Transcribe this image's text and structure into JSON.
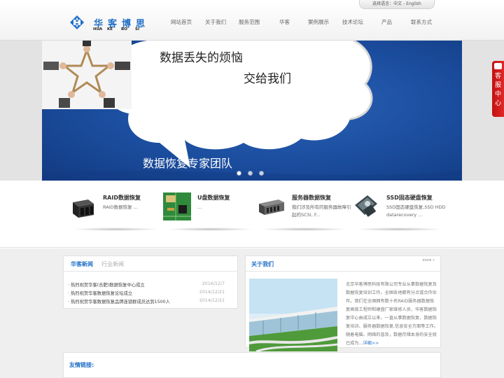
{
  "header": {
    "language": {
      "label": "选择语言：",
      "zh": "中文",
      "sep": " - ",
      "en": "English"
    },
    "logo": {
      "cn": "华客博思",
      "en": [
        "HUA",
        "KE",
        "BO",
        "SI"
      ]
    },
    "nav": [
      "网站首页",
      "关于我们",
      "服务范围",
      "华客",
      "案例展示",
      "技术论坛",
      "产品",
      "联系方式"
    ]
  },
  "banner": {
    "line1": "数据丢失的烦恼",
    "line2": "交给我们",
    "line3": "数据恢复专家团队",
    "slide_count": 3,
    "active_slide": 1
  },
  "side_tab": {
    "label": "客服中心"
  },
  "services": [
    {
      "title": "RAID数据恢复",
      "desc": "RAID数据恢复 ..."
    },
    {
      "title": "U盘数据恢复",
      "desc": "..."
    },
    {
      "title": "服务器数据恢复",
      "desc": "我们涉及所有的服务器故障引起的SCSI, F..."
    },
    {
      "title": "SSD固态硬盘恢复",
      "desc": "SSD固态硬盘恢复,SSD HDD datarecovery ..."
    }
  ],
  "news": {
    "tabs": [
      "华客新闻",
      "行业新闻"
    ],
    "items": [
      {
        "title": "· 热烈祝贺华客(合肥)数据恢复中心成立",
        "date": "2016/12/7"
      },
      {
        "title": "· 热烈祝贺华客数据恢复论坛成立",
        "date": "2014/12/21"
      },
      {
        "title": "· 热烈祝贺华客数据恢复品牌连锁群成员达到1500人",
        "date": "2014/12/21"
      }
    ]
  },
  "about": {
    "title": "关于我们",
    "more": "more »",
    "text": "北京华客博思科技有限公司专业从事数据恢复及数据恢复培训工作，全国各地都有分点或合作伙伴。我们在全国拥有数十名RAID服务器数据恢复高级工程师和硬盘厂家维修人员，华客数据恢复中心由成立以来，一直从事数据恢复、数据恢复培训、服务器数据恢复,信息安全方面等工作。随着电脑、网络的普及，数据存储本身的安全就已成为...",
    "link": "详细>>"
  },
  "links": {
    "title": "友情链接:"
  },
  "colors": {
    "brand": "#1f6fc7",
    "banner": "#1b4d9e",
    "side_tab": "#d01818"
  }
}
